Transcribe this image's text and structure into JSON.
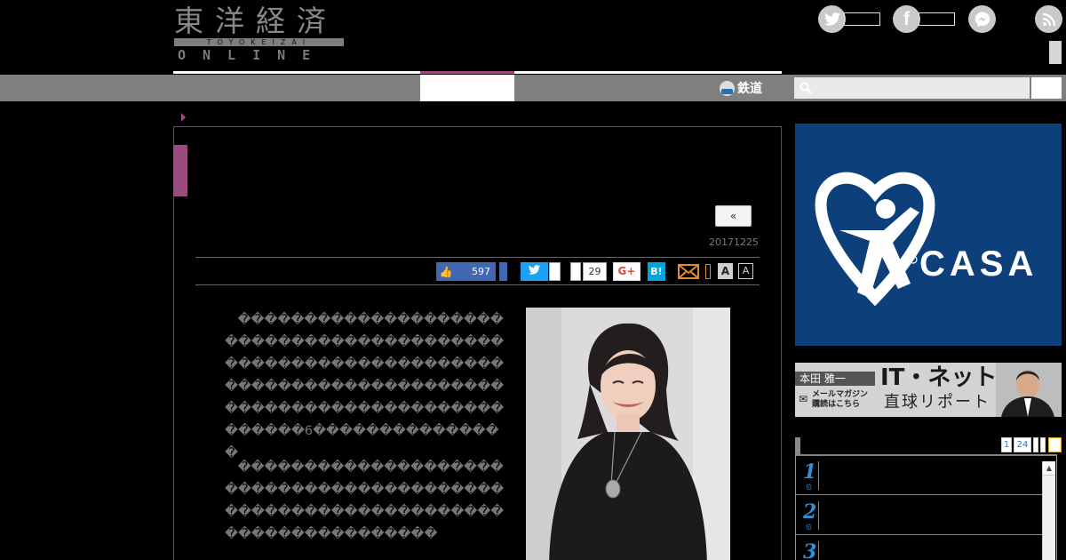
{
  "header": {
    "logo_kanji": "東洋経済",
    "logo_band": "TOYOKEIZAI",
    "logo_sub": "ONLINE"
  },
  "social": {
    "twitter_icon": "twitter-icon",
    "facebook_icon": "facebook-icon",
    "messenger_icon": "messenger-icon",
    "rss_icon": "rss-icon"
  },
  "nav": {
    "tetsudo_label": "鉄道",
    "accent_color": "#9b4b7e"
  },
  "article": {
    "prev_label": "«",
    "date": "20171225",
    "share": {
      "like_count": "597",
      "pocket_count": "29",
      "gplus_label": "G+",
      "hatena_label": "B!",
      "font_large": "A",
      "font_small": "A"
    },
    "para1_number": "6"
  },
  "sidebar": {
    "casa_text": "CASA",
    "honda_name": "本田 雅一",
    "honda_title": "IT・ネット",
    "honda_sub": "直球リポート",
    "honda_mail1": "メールマガジン",
    "honda_mail2": "購読はこちら",
    "ranking": {
      "tabs": [
        "1",
        "24"
      ],
      "ranks": [
        "1",
        "2",
        "3"
      ]
    }
  }
}
